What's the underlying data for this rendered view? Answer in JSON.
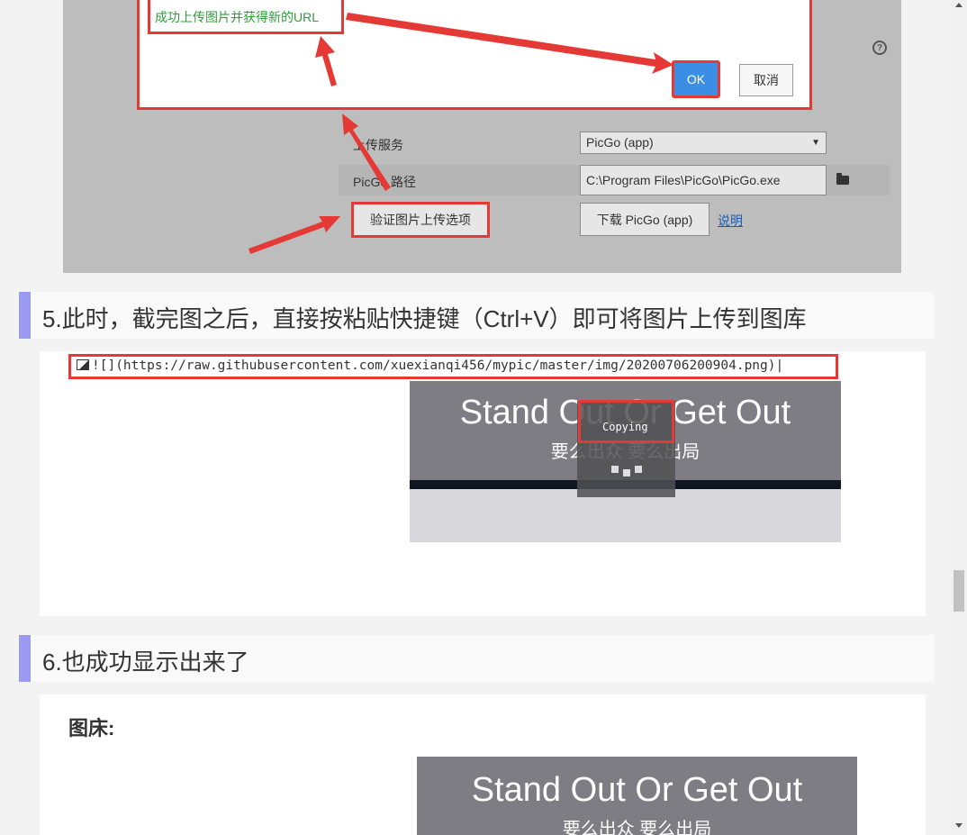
{
  "dialog": {
    "success_message": "成功上传图片并获得新的URL",
    "ok_label": "OK",
    "cancel_label": "取消",
    "help_icon": "?"
  },
  "settings": {
    "upload_service_label": "上传服务",
    "upload_service_value": "PicGo (app)",
    "picgo_path_label": "PicGo 路径",
    "picgo_path_value": "C:\\Program Files\\PicGo\\PicGo.exe",
    "verify_button": "验证图片上传选项",
    "download_button": "下载 PicGo (app)",
    "help_link": "说明"
  },
  "step5": {
    "heading": "5.此时，截完图之后，直接按粘贴快捷键（Ctrl+V）即可将图片上传到图库",
    "code_text": "![](https://raw.githubusercontent.com/xuexianqi456/mypic/master/img/20200706200904.png)",
    "banner_title": "Stand Out Or Get Out",
    "banner_subtitle": "要么出众 要么出局",
    "copying_text": "Copying"
  },
  "step6": {
    "heading": "6.也成功显示出来了",
    "subheading": "图床:",
    "banner_title": "Stand Out Or Get Out",
    "banner_subtitle": "要么出众 要么出局"
  },
  "colors": {
    "highlight_red": "#e53935",
    "ok_blue": "#3a8ee6",
    "success_green": "#2e9d3a",
    "heading_accent": "#9a9af0"
  }
}
